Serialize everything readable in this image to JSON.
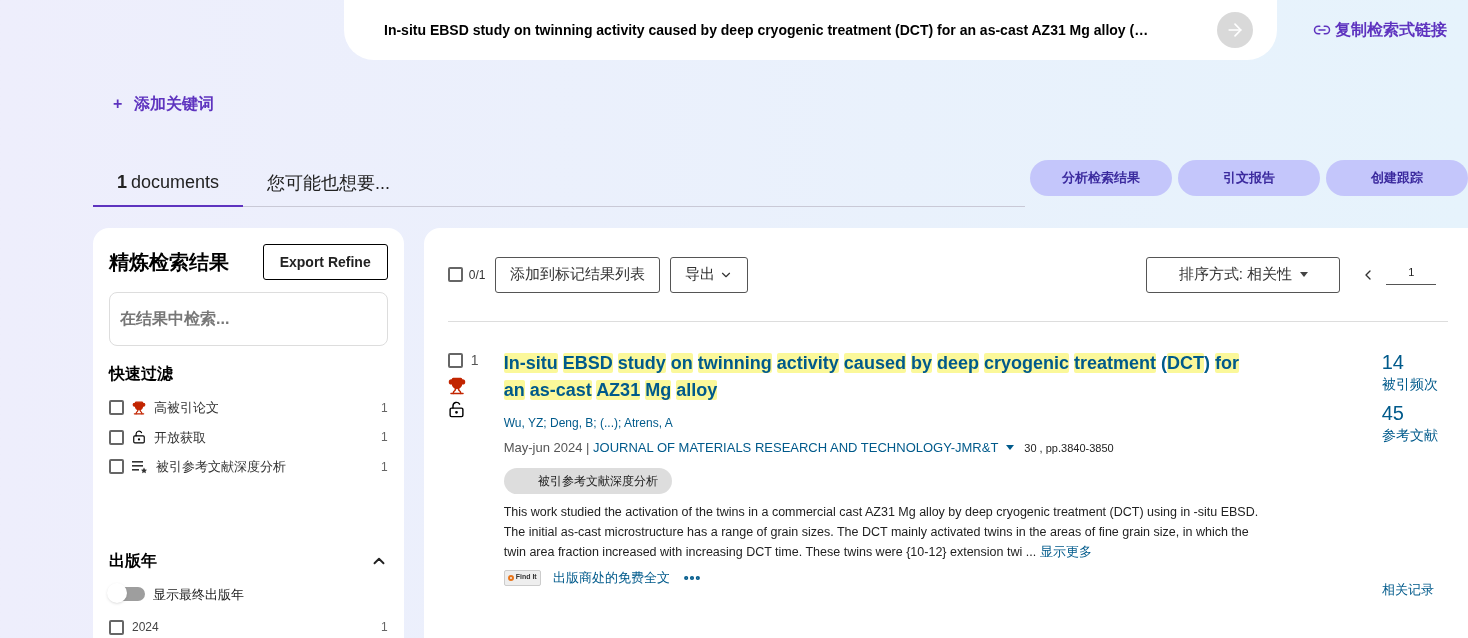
{
  "search_bar": {
    "query": "In-situ EBSD study on twinning activity caused by deep cryogenic treatment (DCT) for an as-cast AZ31 Mg alloy (…",
    "copy_link": "复制检索式链接"
  },
  "add_keyword": {
    "icon": "+",
    "label": "添加关键词"
  },
  "tabs": [
    {
      "count": "1",
      "label": "documents",
      "selected": true
    },
    {
      "label": "您可能也想要...",
      "selected": false
    }
  ],
  "actions": [
    "分析检索结果",
    "引文报告",
    "创建跟踪"
  ],
  "refine": {
    "title": "精炼检索结果",
    "export": "Export Refine",
    "search_placeholder": "在结果中检索...",
    "quick_filter_title": "快速过滤",
    "quick_filters": [
      {
        "kind": "trophy",
        "label": "高被引论文",
        "count": "1",
        "checked": false
      },
      {
        "kind": "lock",
        "label": "开放获取",
        "count": "1",
        "checked": false
      },
      {
        "kind": "list",
        "label": "被引参考文献深度分析",
        "count": "1",
        "checked": false
      }
    ],
    "year_section": {
      "title": "出版年",
      "expanded": true,
      "toggle_label": "显示最终出版年",
      "toggle_on": false,
      "years": [
        {
          "label": "2024",
          "count": "1",
          "checked": false
        }
      ]
    }
  },
  "toolbar": {
    "select_count": "0/1",
    "select_all": false,
    "add_to_marked": "添加到标记结果列表",
    "export": "导出",
    "sort": "排序方式: 相关性",
    "page": "1"
  },
  "records": [
    {
      "number": "1",
      "checked": false,
      "highly_cited": true,
      "open_access": true,
      "title": [
        {
          "text": "In-situ",
          "highlighted": true
        },
        {
          "text": "EBSD",
          "highlighted": true
        },
        {
          "text": "study",
          "highlighted": true
        },
        {
          "text": "on",
          "highlighted": true
        },
        {
          "text": "twinning",
          "highlighted": true
        },
        {
          "text": "activity",
          "highlighted": true
        },
        {
          "text": "caused",
          "highlighted": true
        },
        {
          "text": "by",
          "highlighted": true
        },
        {
          "text": "deep",
          "highlighted": true
        },
        {
          "text": "cryogenic",
          "highlighted": true
        },
        {
          "text": "treatment",
          "highlighted": true
        },
        {
          "text": "(",
          "highlighted": false
        },
        {
          "text": "DCT",
          "highlighted": true,
          "attached": true
        },
        {
          "text": ")",
          "highlighted": false,
          "attached": true
        },
        {
          "text": "for",
          "highlighted": true
        },
        {
          "text": "an",
          "highlighted": true
        },
        {
          "text": "as-cast",
          "highlighted": true
        },
        {
          "text": "AZ31",
          "highlighted": true
        },
        {
          "text": "Mg",
          "highlighted": true
        },
        {
          "text": "alloy",
          "highlighted": true
        }
      ],
      "authors": [
        {
          "name": "Wu, YZ"
        },
        {
          "name": "Deng, B"
        },
        {
          "name": "(...)"
        },
        {
          "name": "Atrens, A"
        }
      ],
      "author_separator": ";",
      "date": "May-jun 2024 |",
      "journal": "JOURNAL OF MATERIALS RESEARCH AND TECHNOLOGY-JMR&T",
      "volume_pages": "30 , pp.3840-3850",
      "badge": "被引参考文献深度分析",
      "abstract": "This work studied the activation of the twins in a commercial cast AZ31 Mg alloy by deep cryogenic treatment (DCT) using in -situ EBSD. The initial as-cast microstructure has a range of grain sizes. The DCT mainly activated twins in the areas of fine grain size, in which the twin area fraction increased with increasing DCT time. These twins were {10-12} extension twi",
      "ellipsis": "...",
      "show_more": "显示更多",
      "find_it": "Find It",
      "full_text": "出版商处的免费全文",
      "times_cited": "14",
      "times_cited_label": "被引频次",
      "references": "45",
      "references_label": "参考文献",
      "related": "相关记录"
    }
  ]
}
